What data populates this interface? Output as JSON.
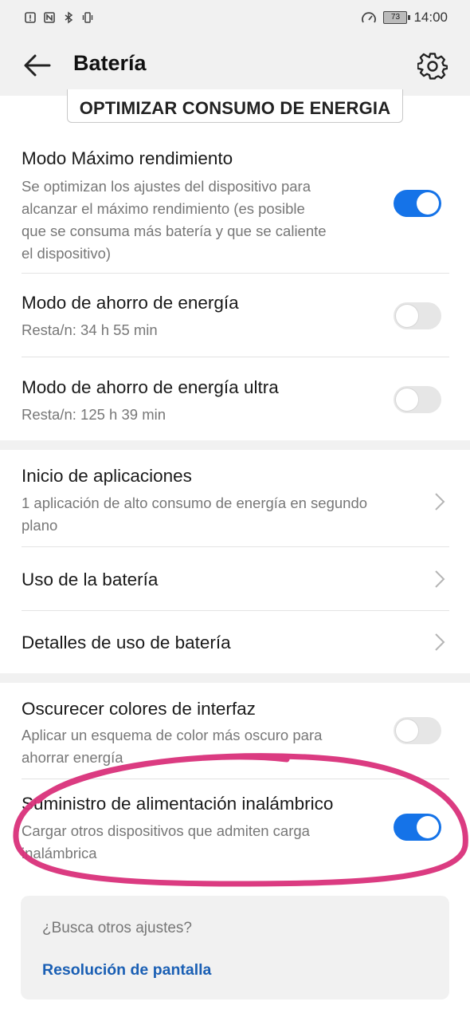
{
  "status_bar": {
    "time": "14:00",
    "battery_level": "73"
  },
  "header": {
    "title": "Batería"
  },
  "optimize_button": {
    "label": "OPTIMIZAR CONSUMO DE ENERGIA"
  },
  "settings": {
    "max_performance": {
      "title": "Modo Máximo rendimiento",
      "subtitle_lines": [
        "Se optimizan los ajustes del dispositivo para",
        "alcanzar el máximo rendimiento (es posible",
        "que se consuma más batería y que se caliente",
        "el dispositivo)"
      ],
      "toggle_on": true
    },
    "power_saving": {
      "title": "Modo de ahorro de energía",
      "subtitle": "Resta/n: 34 h 55 min",
      "toggle_on": false
    },
    "ultra_power_saving": {
      "title": "Modo de ahorro de energía ultra",
      "subtitle": "Resta/n: 125 h 39 min",
      "toggle_on": false
    },
    "app_launch": {
      "title": "Inicio de aplicaciones",
      "subtitle_lines": [
        "1 aplicación de alto consumo de energía en segundo",
        "plano"
      ]
    },
    "battery_usage": {
      "title": "Uso de la batería"
    },
    "battery_usage_details": {
      "title": "Detalles de uso de batería"
    },
    "darken_colors": {
      "title": "Oscurecer colores de interfaz",
      "subtitle_lines": [
        "Aplicar un esquema de color más oscuro para",
        "ahorrar energía"
      ],
      "toggle_on": false
    },
    "wireless_reverse_charging": {
      "title": "Suministro de alimentación inalámbrico",
      "subtitle_lines": [
        "Cargar otros dispositivos que admiten carga",
        "inalámbrica"
      ],
      "toggle_on": true
    }
  },
  "suggestion_card": {
    "question": "¿Busca otros ajustes?",
    "link": "Resolución de pantalla"
  },
  "colors": {
    "accent": "#1573e8",
    "annotation": "#d9307a",
    "link": "#1a5fb4"
  },
  "icons": {
    "back": "arrow-left-icon",
    "settings": "gear-icon",
    "chevron": "chevron-right-icon",
    "status": [
      "alert-icon",
      "nfc-icon",
      "bluetooth-icon",
      "vibrate-icon",
      "speedometer-icon",
      "battery-icon"
    ]
  }
}
